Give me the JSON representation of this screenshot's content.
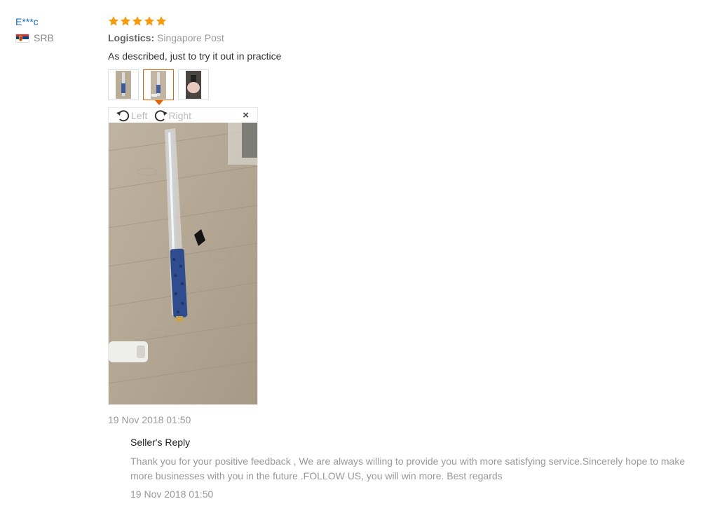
{
  "user": {
    "name": "E***c",
    "country": "SRB",
    "flag_icon": "serbia-flag-icon"
  },
  "review": {
    "rating": 5,
    "rating_max": 5,
    "star_color": "#f39c12",
    "logistics_label": "Logistics:",
    "logistics_value": "Singapore Post",
    "content": "As described, just to try it out in practice",
    "thumbnails": [
      {
        "name": "photo-thumb-1",
        "active": false
      },
      {
        "name": "photo-thumb-2",
        "active": true
      },
      {
        "name": "photo-thumb-3",
        "active": false
      }
    ],
    "viewer": {
      "rotate_left_label": "Left",
      "rotate_right_label": "Right",
      "close_glyph": "×"
    },
    "date": "19 Nov 2018 01:50"
  },
  "seller_reply": {
    "title": "Seller's Reply",
    "text": "Thank you for your positive feedback , We are always willing to provide you with more satisfying service.Sincerely hope to make more businesses with you in the future .FOLLOW US, you will win more. Best regards",
    "date": "19 Nov 2018 01:50"
  },
  "colors": {
    "username": "#1a6cc4",
    "accent": "#e2630b",
    "muted_text": "#999999"
  }
}
